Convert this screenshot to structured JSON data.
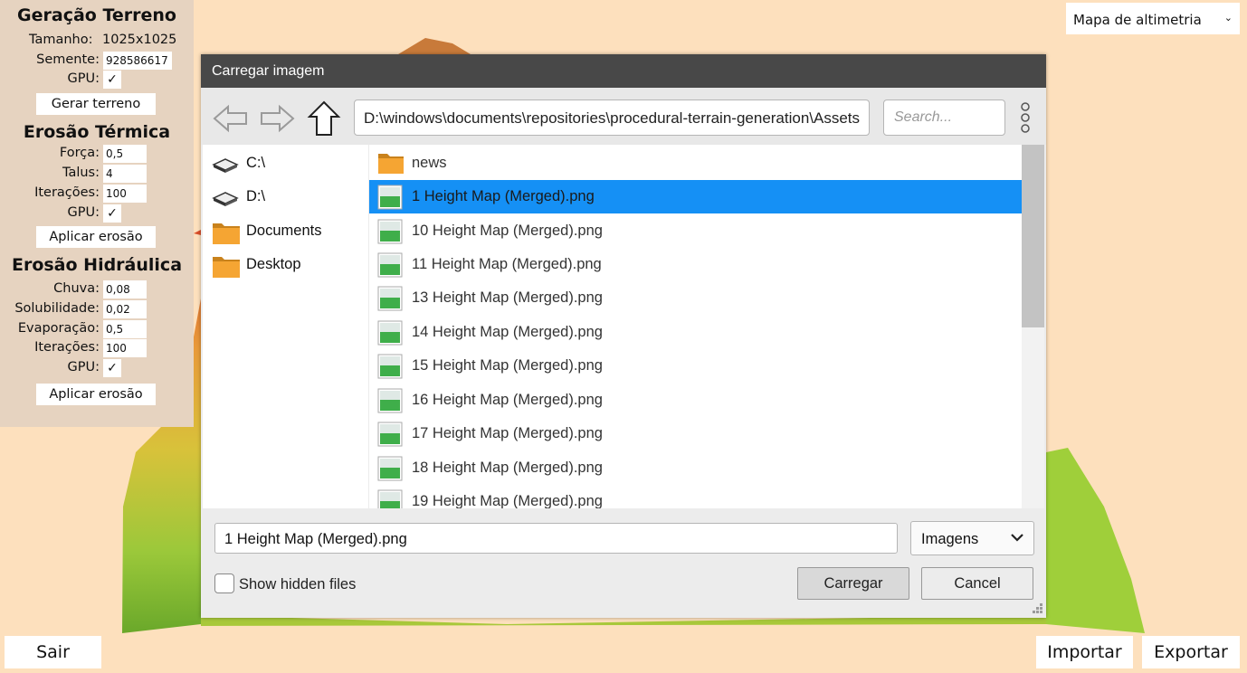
{
  "left_panel": {
    "terrain_generation": {
      "heading": "Geração Terreno",
      "size_label": "Tamanho:",
      "size_value": "1025x1025",
      "seed_label": "Semente:",
      "seed_value": "928586617",
      "gpu_label": "GPU:",
      "gpu_checked": "✓",
      "button": "Gerar terreno"
    },
    "thermal_erosion": {
      "heading": "Erosão Térmica",
      "force_label": "Força:",
      "force_value": "0,5",
      "talus_label": "Talus:",
      "talus_value": "4",
      "iterations_label": "Iterações:",
      "iterations_value": "100",
      "gpu_label": "GPU:",
      "gpu_checked": "✓",
      "button": "Aplicar erosão"
    },
    "hydraulic_erosion": {
      "heading": "Erosão Hidráulica",
      "rain_label": "Chuva:",
      "rain_value": "0,08",
      "solubility_label": "Solubilidade:",
      "solubility_value": "0,02",
      "evaporation_label": "Evaporação:",
      "evaporation_value": "0,5",
      "iterations_label": "Iterações:",
      "iterations_value": "100",
      "gpu_label": "GPU:",
      "gpu_checked": "✓",
      "button": "Aplicar erosão"
    }
  },
  "view_select": {
    "value": "Mapa de altimetria",
    "chevron": "⌄"
  },
  "bottom_buttons": {
    "exit": "Sair",
    "import": "Importar",
    "export": "Exportar"
  },
  "dialog": {
    "title": "Carregar imagem",
    "path": "D:\\windows\\documents\\repositories\\procedural-terrain-generation\\Assets",
    "search_placeholder": "Search...",
    "sidebar": [
      {
        "label": "C:\\",
        "icon": "drive-icon"
      },
      {
        "label": "D:\\",
        "icon": "drive-icon"
      },
      {
        "label": "Documents",
        "icon": "folder-icon"
      },
      {
        "label": "Desktop",
        "icon": "folder-icon"
      }
    ],
    "files": [
      {
        "name": "news",
        "icon": "folder-icon"
      },
      {
        "name": "1 Height Map (Merged).png",
        "icon": "image-file-icon",
        "selected": true
      },
      {
        "name": "10 Height Map (Merged).png",
        "icon": "image-file-icon"
      },
      {
        "name": "11 Height Map (Merged).png",
        "icon": "image-file-icon"
      },
      {
        "name": "13 Height Map (Merged).png",
        "icon": "image-file-icon"
      },
      {
        "name": "14 Height Map (Merged).png",
        "icon": "image-file-icon"
      },
      {
        "name": "15 Height Map (Merged).png",
        "icon": "image-file-icon"
      },
      {
        "name": "16 Height Map (Merged).png",
        "icon": "image-file-icon"
      },
      {
        "name": "17 Height Map (Merged).png",
        "icon": "image-file-icon"
      },
      {
        "name": "18 Height Map (Merged).png",
        "icon": "image-file-icon"
      },
      {
        "name": "19 Height Map (Merged).png",
        "icon": "image-file-icon"
      }
    ],
    "filename_value": "1 Height Map (Merged).png",
    "filetype": "Imagens",
    "show_hidden_label": "Show hidden files",
    "load_button": "Carregar",
    "cancel_button": "Cancel"
  },
  "colors": {
    "background": "#fde0bd",
    "panel": "#e6d3c0",
    "dialog_title": "#484848",
    "selection": "#1590f5"
  }
}
